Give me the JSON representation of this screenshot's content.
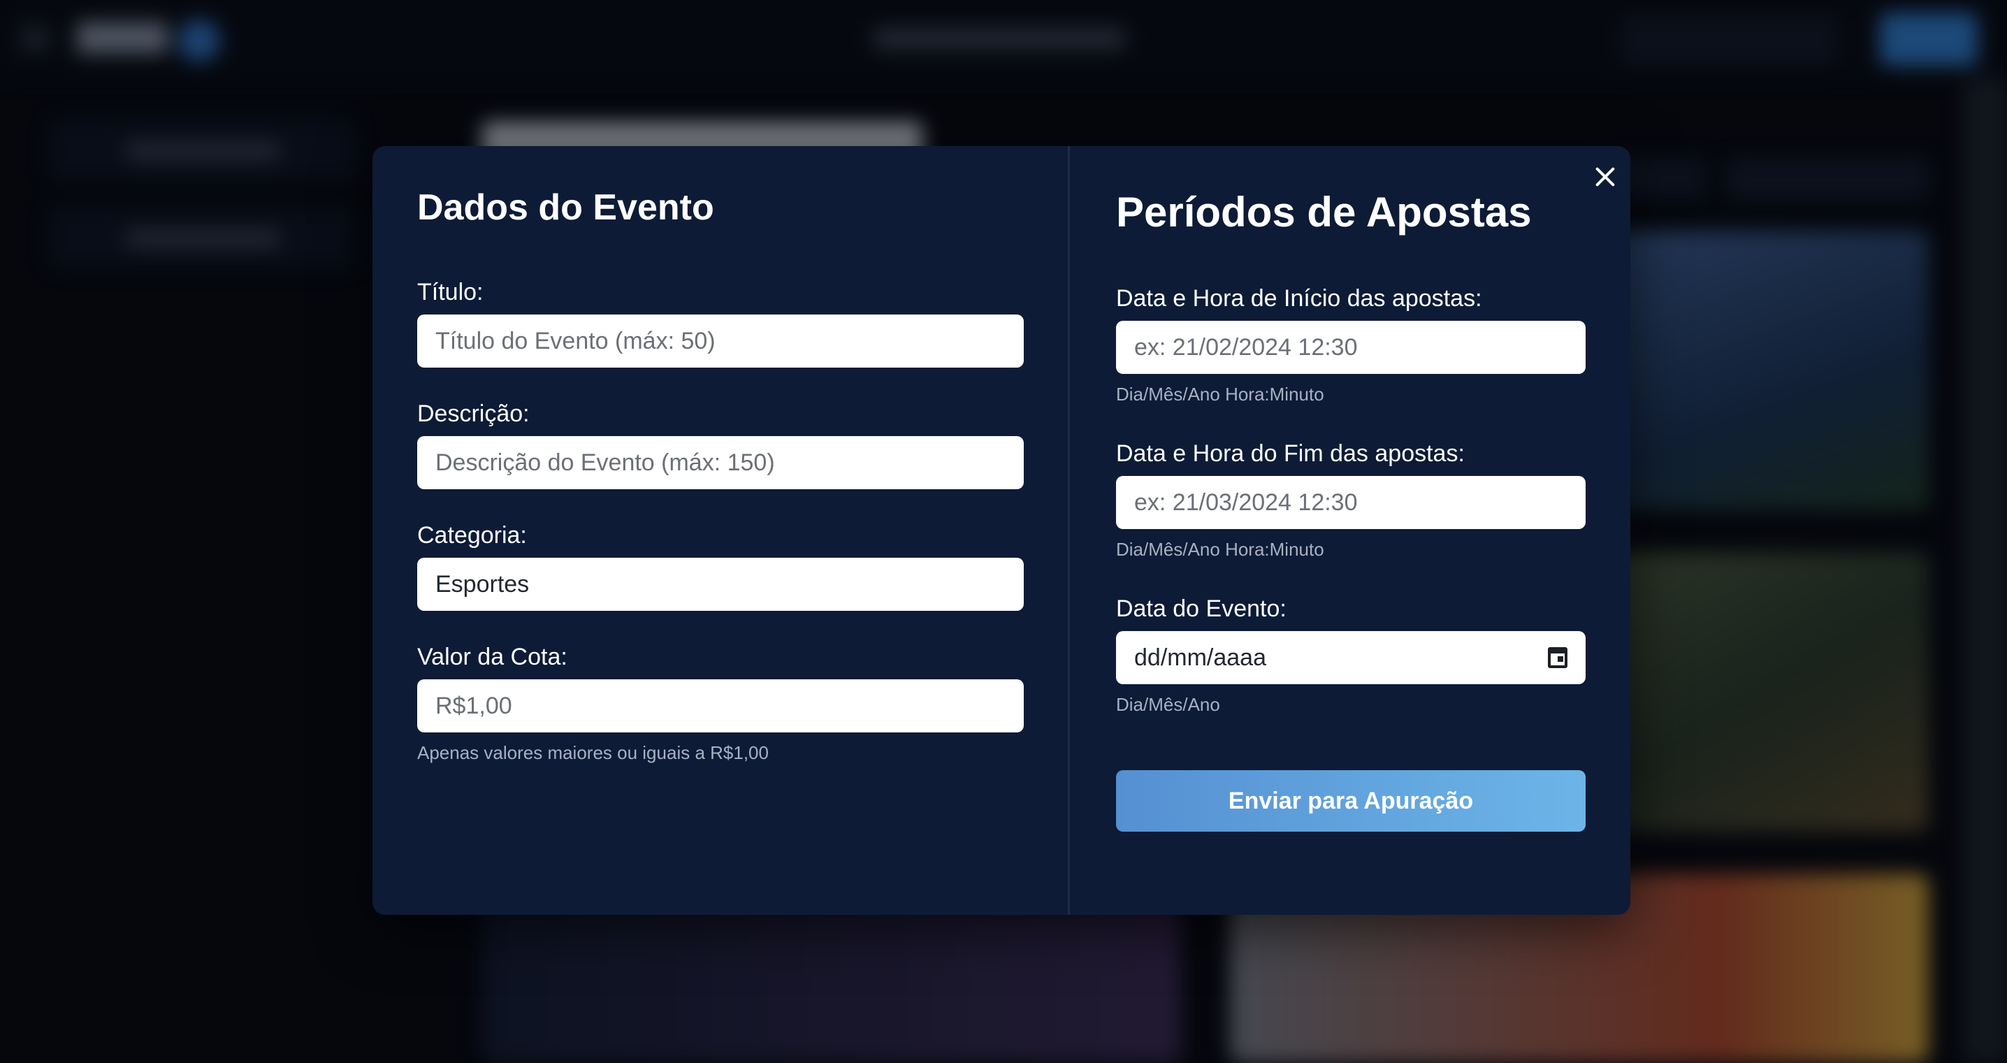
{
  "modal": {
    "close_icon": "close-icon",
    "left": {
      "title": "Dados do Evento",
      "titulo_label": "Título:",
      "titulo_placeholder": "Título do Evento (máx: 50)",
      "descricao_label": "Descrição:",
      "descricao_placeholder": "Descrição do Evento (máx: 150)",
      "categoria_label": "Categoria:",
      "categoria_value": "Esportes",
      "valor_label": "Valor da Cota:",
      "valor_placeholder": "R$1,00",
      "valor_hint": "Apenas valores maiores ou iguais a R$1,00"
    },
    "right": {
      "title": "Períodos de Apostas",
      "inicio_label": "Data e Hora de Início das apostas:",
      "inicio_placeholder": "ex: 21/02/2024 12:30",
      "inicio_hint": "Dia/Mês/Ano Hora:Minuto",
      "fim_label": "Data e Hora do Fim das apostas:",
      "fim_placeholder": "ex: 21/03/2024 12:30",
      "fim_hint": "Dia/Mês/Ano Hora:Minuto",
      "evento_label": "Data do Evento:",
      "evento_value": "dd/mm/aaaa",
      "evento_icon": "calendar-icon",
      "evento_hint": "Dia/Mês/Ano",
      "submit_label": "Enviar para Apuração"
    }
  },
  "colors": {
    "modal_bg": "#0d1b36",
    "submit_gradient_start": "#5590d2",
    "submit_gradient_end": "#6cb5e8",
    "hint_text": "#a8b1c2"
  }
}
